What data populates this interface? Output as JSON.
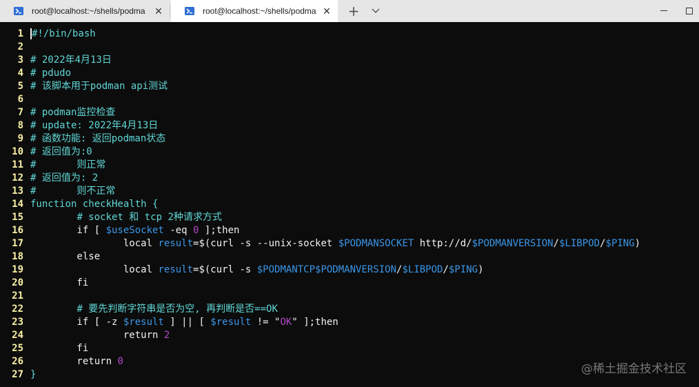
{
  "tabs": [
    {
      "label": "root@localhost:~/shells/podma",
      "active": false
    },
    {
      "label": "root@localhost:~/shells/podma",
      "active": true
    }
  ],
  "newtab_symbol": "+",
  "close_symbol": "✕",
  "window_controls": {
    "minimize": "—",
    "maximize": "☐"
  },
  "watermark": "@稀土掘金技术社区",
  "lines": [
    {
      "n": "1",
      "segs": [
        {
          "t": "#!/bin/bash",
          "c": "c-comment"
        }
      ]
    },
    {
      "n": "2",
      "segs": []
    },
    {
      "n": "3",
      "segs": [
        {
          "t": "# 2022年4月13日",
          "c": "c-comment"
        }
      ]
    },
    {
      "n": "4",
      "segs": [
        {
          "t": "# pdudo",
          "c": "c-comment"
        }
      ]
    },
    {
      "n": "5",
      "segs": [
        {
          "t": "# 该脚本用于podman api测试",
          "c": "c-comment"
        }
      ]
    },
    {
      "n": "6",
      "segs": []
    },
    {
      "n": "7",
      "segs": [
        {
          "t": "# podman监控检查",
          "c": "c-comment"
        }
      ]
    },
    {
      "n": "8",
      "segs": [
        {
          "t": "# update: 2022年4月13日",
          "c": "c-comment"
        }
      ]
    },
    {
      "n": "9",
      "segs": [
        {
          "t": "# 函数功能: 返回podman状态",
          "c": "c-comment"
        }
      ]
    },
    {
      "n": "10",
      "segs": [
        {
          "t": "# 返回值为:0",
          "c": "c-comment"
        }
      ]
    },
    {
      "n": "11",
      "segs": [
        {
          "t": "#       则正常",
          "c": "c-comment"
        }
      ]
    },
    {
      "n": "12",
      "segs": [
        {
          "t": "# 返回值为: 2",
          "c": "c-comment"
        }
      ]
    },
    {
      "n": "13",
      "segs": [
        {
          "t": "#       则不正常",
          "c": "c-comment"
        }
      ]
    },
    {
      "n": "14",
      "segs": [
        {
          "t": "function checkHealth {",
          "c": "c-fn"
        }
      ]
    },
    {
      "n": "15",
      "segs": [
        {
          "t": "        ",
          "c": "c-plain"
        },
        {
          "t": "# socket 和 tcp 2种请求方式",
          "c": "c-comment"
        }
      ]
    },
    {
      "n": "16",
      "segs": [
        {
          "t": "        if [ ",
          "c": "c-kw"
        },
        {
          "t": "$useSocket",
          "c": "c-var"
        },
        {
          "t": " -eq ",
          "c": "c-plain"
        },
        {
          "t": "0",
          "c": "c-num"
        },
        {
          "t": " ];then",
          "c": "c-kw"
        }
      ]
    },
    {
      "n": "17",
      "segs": [
        {
          "t": "                local ",
          "c": "c-kw"
        },
        {
          "t": "result",
          "c": "c-var2"
        },
        {
          "t": "=$(curl -s --unix-socket ",
          "c": "c-plain"
        },
        {
          "t": "$PODMANSOCKET",
          "c": "c-var"
        },
        {
          "t": " http://d/",
          "c": "c-url"
        },
        {
          "t": "$PODMANVERSION",
          "c": "c-var"
        },
        {
          "t": "/",
          "c": "c-plain"
        },
        {
          "t": "$LIBPOD",
          "c": "c-var"
        },
        {
          "t": "/",
          "c": "c-plain"
        },
        {
          "t": "$PING",
          "c": "c-var"
        },
        {
          "t": ")",
          "c": "c-plain"
        }
      ]
    },
    {
      "n": "18",
      "segs": [
        {
          "t": "        else",
          "c": "c-kw"
        }
      ]
    },
    {
      "n": "19",
      "segs": [
        {
          "t": "                local ",
          "c": "c-kw"
        },
        {
          "t": "result",
          "c": "c-var2"
        },
        {
          "t": "=$(curl -s ",
          "c": "c-plain"
        },
        {
          "t": "$PODMANTCP$PODMANVERSION",
          "c": "c-var"
        },
        {
          "t": "/",
          "c": "c-plain"
        },
        {
          "t": "$LIBPOD",
          "c": "c-var"
        },
        {
          "t": "/",
          "c": "c-plain"
        },
        {
          "t": "$PING",
          "c": "c-var"
        },
        {
          "t": ")",
          "c": "c-plain"
        }
      ]
    },
    {
      "n": "20",
      "segs": [
        {
          "t": "        fi",
          "c": "c-kw"
        }
      ]
    },
    {
      "n": "21",
      "segs": []
    },
    {
      "n": "22",
      "segs": [
        {
          "t": "        ",
          "c": "c-plain"
        },
        {
          "t": "# 要先判断字符串是否为空, 再判断是否==OK",
          "c": "c-comment"
        }
      ]
    },
    {
      "n": "23",
      "segs": [
        {
          "t": "        if [ -z ",
          "c": "c-kw"
        },
        {
          "t": "$result",
          "c": "c-var"
        },
        {
          "t": " ] || [ ",
          "c": "c-plain"
        },
        {
          "t": "$result",
          "c": "c-var"
        },
        {
          "t": " != \"",
          "c": "c-plain"
        },
        {
          "t": "OK",
          "c": "c-str"
        },
        {
          "t": "\" ];then",
          "c": "c-kw"
        }
      ]
    },
    {
      "n": "24",
      "segs": [
        {
          "t": "                return ",
          "c": "c-kw"
        },
        {
          "t": "2",
          "c": "c-num"
        }
      ]
    },
    {
      "n": "25",
      "segs": [
        {
          "t": "        fi",
          "c": "c-kw"
        }
      ]
    },
    {
      "n": "26",
      "segs": [
        {
          "t": "        return ",
          "c": "c-kw"
        },
        {
          "t": "0",
          "c": "c-num"
        }
      ]
    },
    {
      "n": "27",
      "segs": [
        {
          "t": "}",
          "c": "c-fn"
        }
      ]
    }
  ]
}
